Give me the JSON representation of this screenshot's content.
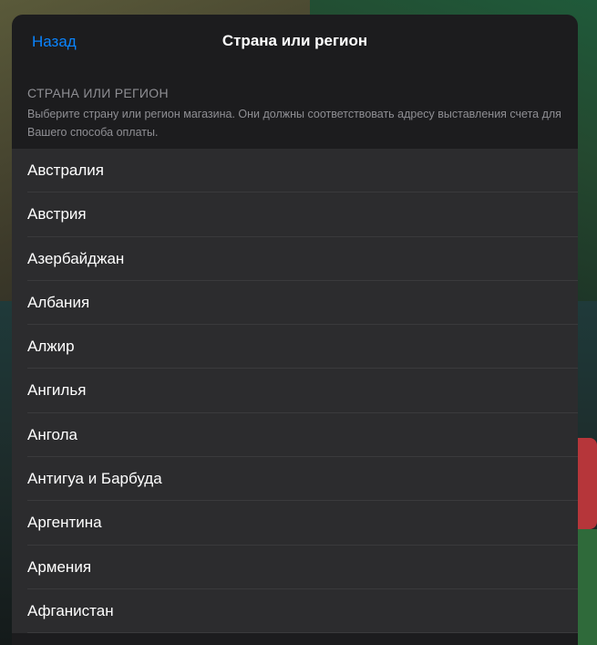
{
  "nav": {
    "back_label": "Назад",
    "title": "Страна или регион"
  },
  "section": {
    "title": "СТРАНА ИЛИ РЕГИОН",
    "description": "Выберите страну или регион магазина. Они должны соответствовать адресу выставления счета для Вашего способа оплаты."
  },
  "countries": [
    "Австралия",
    "Австрия",
    "Азербайджан",
    "Албания",
    "Алжир",
    "Ангилья",
    "Ангола",
    "Антигуа и Барбуда",
    "Аргентина",
    "Армения",
    "Афганистан"
  ],
  "colors": {
    "accent": "#0a84ff",
    "sheet_background": "#1c1c1e",
    "cell_background": "#2c2c2e",
    "secondary_text": "#8e8e93"
  }
}
